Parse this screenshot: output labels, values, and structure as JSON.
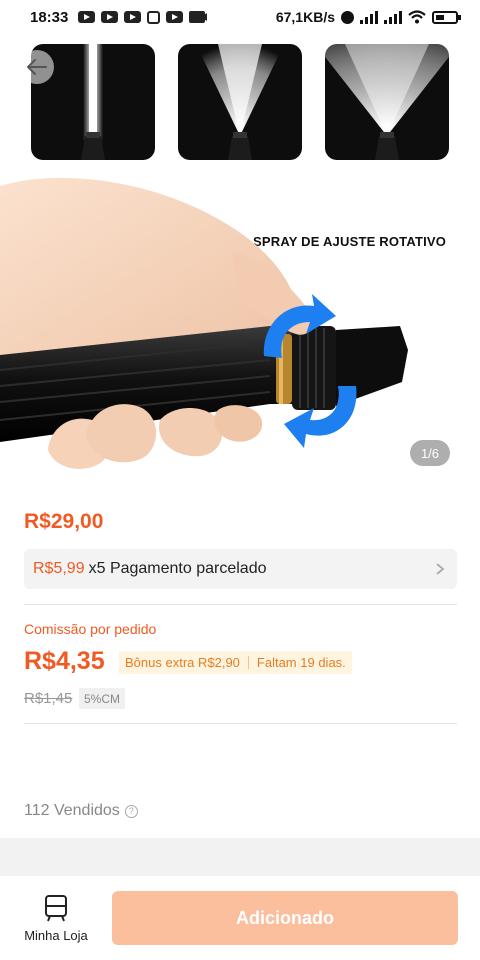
{
  "status_bar": {
    "time": "18:33",
    "network_speed": "67,1KB/s",
    "app_icons": [
      "youtube-icon",
      "youtube-icon",
      "youtube-icon",
      "grid-icon",
      "youtube-icon",
      "camera-icon"
    ]
  },
  "gallery": {
    "caption": "SPRAY DE AJUSTE ROTATIVO",
    "counter": "1/6",
    "thumbnails": [
      "jet-spray",
      "cone-spray",
      "wide-spray"
    ]
  },
  "product": {
    "price": "R$29,00",
    "installment": {
      "price": "R$5,99",
      "text": "x5 Pagamento parcelado"
    },
    "commission": {
      "label": "Comissão por pedido",
      "value": "R$4,35",
      "bonus": "Bônus extra R$2,90",
      "remaining": "Faltam 19 dias.",
      "old_value": "R$1,45",
      "percent": "5%CM"
    },
    "sold": "112 Vendidos"
  },
  "bottom_bar": {
    "store_label": "Minha Loja",
    "add_button": "Adicionado"
  },
  "colors": {
    "accent": "#f15a22",
    "button_disabled": "#fbbf9d",
    "arrow_blue": "#1e7ff0"
  }
}
